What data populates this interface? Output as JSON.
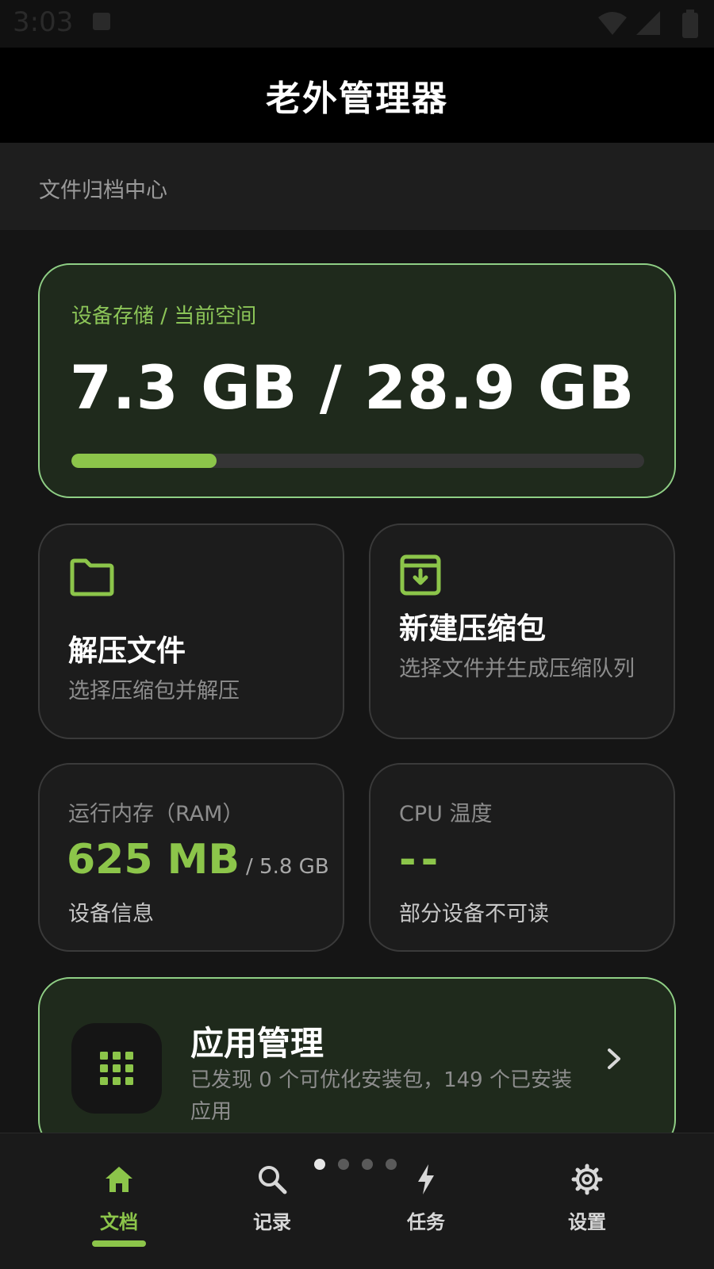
{
  "status_bar": {
    "time": "3:03"
  },
  "app": {
    "title": "老外管理器"
  },
  "section": {
    "label": "文件归档中心"
  },
  "storage": {
    "caption": "设备存储 / 当前空间",
    "value": "7.3 GB / 28.9 GB",
    "used_fraction": 0.253,
    "accent": "#8cc54a"
  },
  "tiles": {
    "extract": {
      "icon": "folder-icon",
      "title": "解压文件",
      "subtitle": "选择压缩包并解压"
    },
    "new_archive": {
      "icon": "archive-download-icon",
      "title": "新建压缩包",
      "subtitle": "选择文件并生成压缩队列"
    }
  },
  "ram": {
    "label": "运行内存（RAM）",
    "used": "625 MB",
    "total": "/ 5.8 GB",
    "sub": "设备信息"
  },
  "cpu": {
    "label": "CPU 温度",
    "value": "--",
    "sub": "部分设备不可读"
  },
  "apps": {
    "icon": "grid-icon",
    "title": "应用管理",
    "subtitle": "已发现 0 个可优化安装包，149 个已安装应用"
  },
  "pager": {
    "count": 4,
    "active": 0
  },
  "nav": [
    {
      "label": "文档",
      "icon": "home-icon",
      "active": true
    },
    {
      "label": "记录",
      "icon": "search-icon",
      "active": false
    },
    {
      "label": "任务",
      "icon": "lightning-icon",
      "active": false
    },
    {
      "label": "设置",
      "icon": "gear-icon",
      "active": false
    }
  ]
}
